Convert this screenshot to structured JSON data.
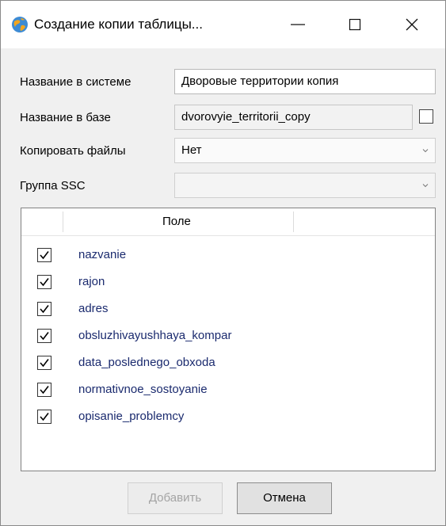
{
  "window": {
    "title": "Создание копии таблицы...",
    "icon": "globe-icon"
  },
  "form": {
    "system_name_label": "Название в системе",
    "system_name_value": "Дворовые территории копия",
    "db_name_label": "Название в базе",
    "db_name_value": "dvorovyie_territorii_copy",
    "db_name_checkbox_checked": false,
    "copy_files_label": "Копировать файлы",
    "copy_files_value": "Нет",
    "ssc_group_label": "Группа SSC",
    "ssc_group_value": ""
  },
  "table": {
    "column_header": "Поле",
    "rows": [
      {
        "name": "nazvanie",
        "checked": true
      },
      {
        "name": "rajon",
        "checked": true
      },
      {
        "name": "adres",
        "checked": true
      },
      {
        "name": "obsluzhivayushhaya_kompar",
        "checked": true
      },
      {
        "name": "data_poslednego_obxoda",
        "checked": true
      },
      {
        "name": "normativnoe_sostoyanie",
        "checked": true
      },
      {
        "name": "opisanie_problemcy",
        "checked": true
      }
    ]
  },
  "buttons": {
    "add_label": "Добавить",
    "cancel_label": "Отмена"
  },
  "colors": {
    "field_text": "#1a2a6e",
    "window_bg": "#f0f0f0"
  }
}
